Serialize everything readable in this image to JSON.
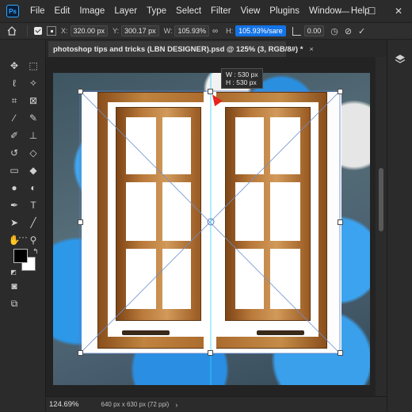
{
  "app": {
    "logo": "Ps"
  },
  "menu": [
    "File",
    "Edit",
    "Image",
    "Layer",
    "Type",
    "Select",
    "Filter",
    "View",
    "Plugins",
    "Window",
    "Help"
  ],
  "window_controls": {
    "minimize": "—",
    "maximize": "☐",
    "close": "✕"
  },
  "options_bar": {
    "x_label": "X:",
    "x_value": "320.00 px",
    "y_label": "Y:",
    "y_value": "300.17 px",
    "w_label": "W:",
    "w_value": "105.93%",
    "h_label": "H:",
    "h_value": "105.93%/sare",
    "angle_value": "0.00",
    "link_icon": "∞"
  },
  "document_tab": {
    "title": "photoshop tips and tricks (LBN DESIGNER).psd @ 125% (3, RGB/8#) *",
    "close": "×"
  },
  "transform_tooltip": {
    "w": "W : 530 px",
    "h": "H : 530 px"
  },
  "status": {
    "zoom": "124.69%",
    "doc_info": "640 px x 630 px (72 ppi)",
    "arrow": "›"
  },
  "colors": {
    "accent": "#1473e6",
    "foreground": "#000000",
    "background": "#ffffff"
  }
}
